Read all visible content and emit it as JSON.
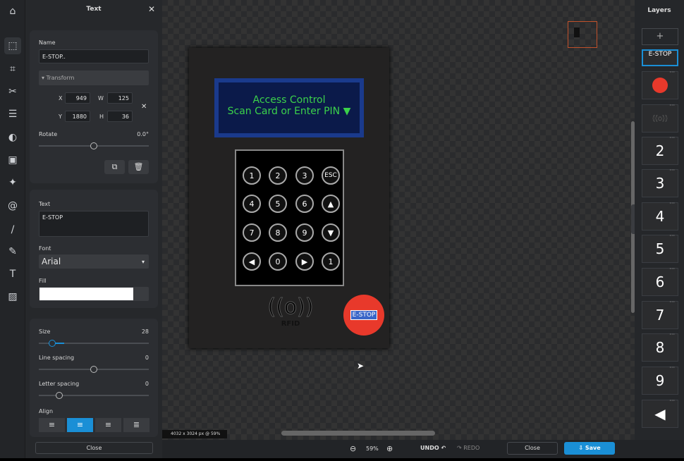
{
  "panel": {
    "title": "Text",
    "name_label": "Name",
    "name_value": "E-STOP..",
    "transform_label": "Transform",
    "x_label": "X",
    "x_value": "949",
    "w_label": "W",
    "w_value": "125",
    "y_label": "Y",
    "y_value": "1880",
    "h_label": "H",
    "h_value": "36",
    "rotate_label": "Rotate",
    "rotate_value": "0.0°",
    "text_label": "Text",
    "text_value": "E-STOP",
    "font_label": "Font",
    "font_value": "Arial",
    "fill_label": "Fill",
    "fill_color": "#ffffff",
    "size_label": "Size",
    "size_value": "28",
    "line_spacing_label": "Line spacing",
    "line_spacing_value": "0",
    "letter_spacing_label": "Letter spacing",
    "letter_spacing_value": "0",
    "align_label": "Align",
    "align_selected": "center",
    "close_label": "Close"
  },
  "canvas": {
    "lcd_line1": "Access Control",
    "lcd_line2": "Scan Card or Enter PIN ▼",
    "keys": [
      "1",
      "2",
      "3",
      "ESC",
      "4",
      "5",
      "6",
      "▲",
      "7",
      "8",
      "9",
      "▼",
      "◀",
      "0",
      "▶",
      "1"
    ],
    "rfid_label": "RFID",
    "estop_label": "E-STOP",
    "image_info": "4032 x 3024 px @ 59%",
    "estop_color": "#e8392b",
    "lcd_text_color": "#3bd14a"
  },
  "layers": {
    "title": "Layers",
    "add_label": "+",
    "items": [
      "E-STOP",
      "",
      "",
      "2",
      "3",
      "4",
      "5",
      "6",
      "7",
      "8",
      "9",
      "◀"
    ]
  },
  "bottombar": {
    "zoom": "59%",
    "undo": "UNDO",
    "redo": "REDO",
    "close": "Close",
    "save": "Save",
    "accent": "#1a8fd6"
  }
}
